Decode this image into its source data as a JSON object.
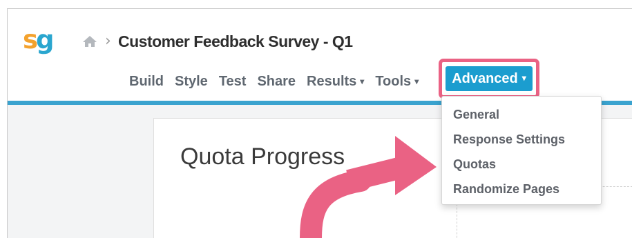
{
  "logo": {
    "s": "s",
    "g": "g"
  },
  "breadcrumb": {
    "home_icon": "home-icon",
    "separator": "›",
    "title": "Customer Feedback Survey - Q1"
  },
  "nav": {
    "items": [
      {
        "label": "Build",
        "has_caret": false
      },
      {
        "label": "Style",
        "has_caret": false
      },
      {
        "label": "Test",
        "has_caret": false
      },
      {
        "label": "Share",
        "has_caret": false
      },
      {
        "label": "Results",
        "has_caret": true
      },
      {
        "label": "Tools",
        "has_caret": true
      }
    ],
    "active": {
      "label": "Advanced",
      "has_caret": true
    },
    "caret": "▾"
  },
  "dropdown": {
    "items": [
      {
        "label": "General"
      },
      {
        "label": "Response Settings"
      },
      {
        "label": "Quotas"
      },
      {
        "label": "Randomize Pages"
      }
    ]
  },
  "card": {
    "title": "Quota Progress"
  },
  "colors": {
    "accent": "#1b9dcf",
    "nav_bar": "#3aa3cf",
    "highlight": "#ea6284",
    "logo_s": "#f4a22d",
    "logo_g": "#2aa6cf"
  }
}
